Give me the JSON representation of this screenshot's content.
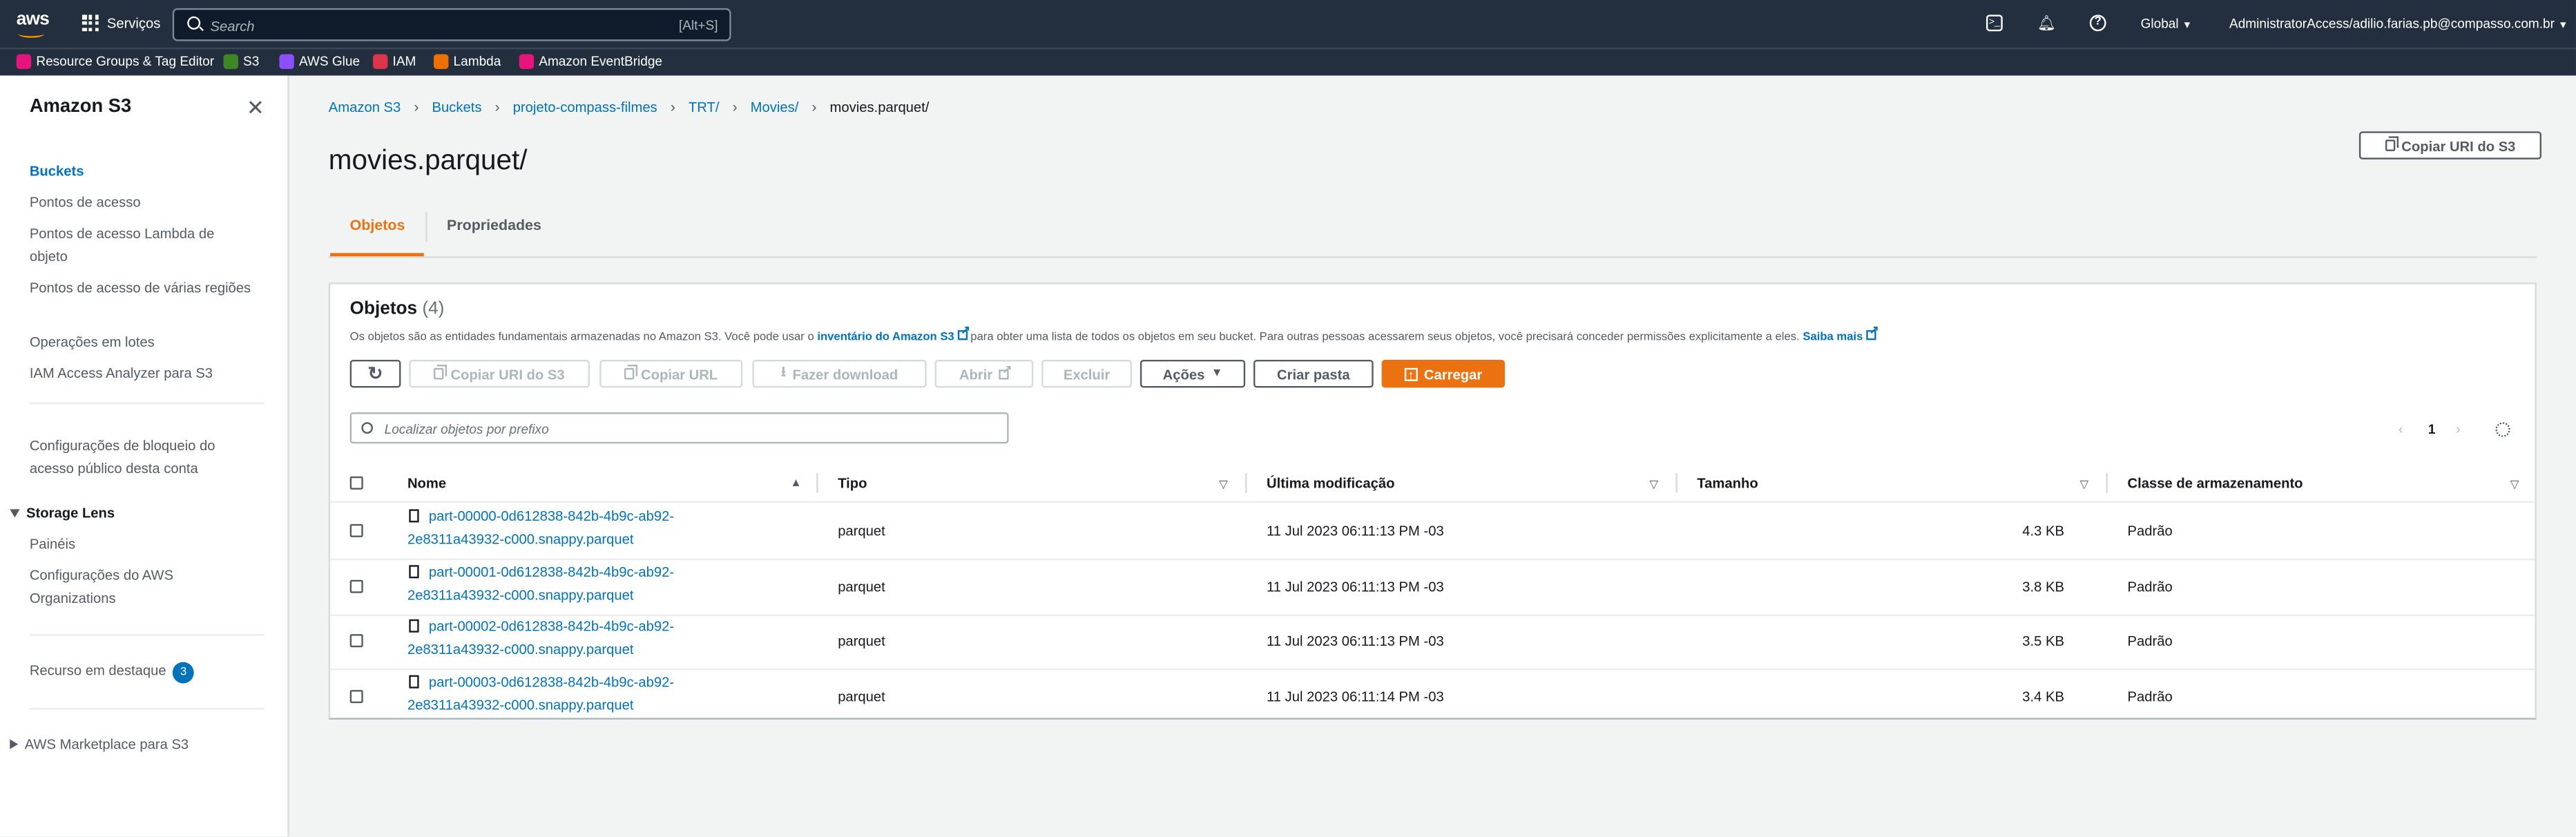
{
  "topbar": {
    "logo": "aws",
    "services_label": "Serviços",
    "search_placeholder": "Search",
    "search_shortcut": "[Alt+S]",
    "region": "Global",
    "account": "AdministratorAccess/adilio.farias.pb@compasso.com.br"
  },
  "favorites": [
    {
      "label": "Resource Groups & Tag Editor",
      "color": "#e7157b"
    },
    {
      "label": "S3",
      "color": "#3f8624"
    },
    {
      "label": "AWS Glue",
      "color": "#8c4fff"
    },
    {
      "label": "IAM",
      "color": "#dd344c"
    },
    {
      "label": "Lambda",
      "color": "#ed7100"
    },
    {
      "label": "Amazon EventBridge",
      "color": "#e7157b"
    }
  ],
  "sidebar": {
    "title": "Amazon S3",
    "items": [
      {
        "label": "Buckets"
      },
      {
        "label": "Pontos de acesso"
      },
      {
        "label": "Pontos de acesso Lambda de objeto"
      },
      {
        "label": "Pontos de acesso de várias regiões"
      },
      {
        "label": "Operações em lotes"
      },
      {
        "label": "IAM Access Analyzer para S3"
      },
      {
        "label": "Configurações de bloqueio do acesso público desta conta"
      }
    ],
    "storage_lens": {
      "label": "Storage Lens",
      "items": [
        "Painéis",
        "Configurações do AWS Organizations"
      ]
    },
    "featured": {
      "label": "Recurso em destaque",
      "count": "3"
    },
    "marketplace": "AWS Marketplace para S3"
  },
  "breadcrumb": [
    "Amazon S3",
    "Buckets",
    "projeto-compass-filmes",
    "TRT/",
    "Movies/",
    "movies.parquet/"
  ],
  "page_title": "movies.parquet/",
  "copy_uri_label": "Copiar URI do S3",
  "tabs": [
    "Objetos",
    "Propriedades"
  ],
  "objects": {
    "title": "Objetos",
    "count": "(4)",
    "desc_1": "Os objetos são as entidades fundamentais armazenadas no Amazon S3. Você pode usar o ",
    "desc_link": "inventário do Amazon S3",
    "desc_2": " para obter uma lista de todos os objetos em seu bucket. Para outras pessoas acessarem seus objetos, você precisará conceder permissões explicitamente a eles. ",
    "desc_more": "Saiba mais",
    "actions": {
      "copy_uri": "Copiar URI do S3",
      "copy_url": "Copiar URL",
      "download": "Fazer download",
      "open": "Abrir",
      "delete": "Excluir",
      "actions": "Ações",
      "create_folder": "Criar pasta",
      "upload": "Carregar"
    },
    "filter_placeholder": "Localizar objetos por prefixo",
    "page": "1",
    "columns": [
      "Nome",
      "Tipo",
      "Última modificação",
      "Tamanho",
      "Classe de armazenamento"
    ],
    "rows": [
      {
        "name_1": "part-00000-0d612838-842b-4b9c-ab92-",
        "name_2": "2e8311a43932-c000.snappy.parquet",
        "type": "parquet",
        "modified": "11 Jul 2023 06:11:13 PM -03",
        "size": "4.3 KB",
        "storage": "Padrão"
      },
      {
        "name_1": "part-00001-0d612838-842b-4b9c-ab92-",
        "name_2": "2e8311a43932-c000.snappy.parquet",
        "type": "parquet",
        "modified": "11 Jul 2023 06:11:13 PM -03",
        "size": "3.8 KB",
        "storage": "Padrão"
      },
      {
        "name_1": "part-00002-0d612838-842b-4b9c-ab92-",
        "name_2": "2e8311a43932-c000.snappy.parquet",
        "type": "parquet",
        "modified": "11 Jul 2023 06:11:13 PM -03",
        "size": "3.5 KB",
        "storage": "Padrão"
      },
      {
        "name_1": "part-00003-0d612838-842b-4b9c-ab92-",
        "name_2": "2e8311a43932-c000.snappy.parquet",
        "type": "parquet",
        "modified": "11 Jul 2023 06:11:14 PM -03",
        "size": "3.4 KB",
        "storage": "Padrão"
      }
    ]
  }
}
